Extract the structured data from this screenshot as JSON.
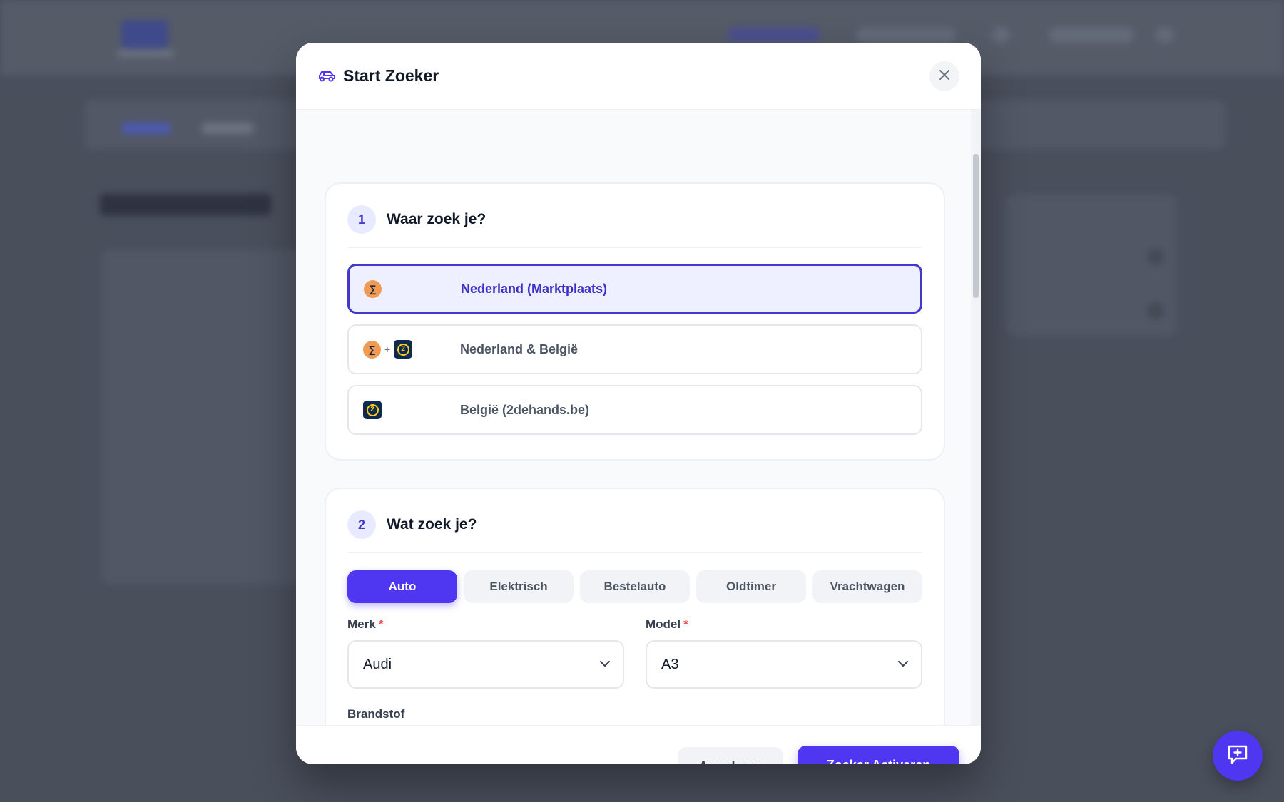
{
  "modal": {
    "title": "Start Zoeker",
    "icon": "car-icon",
    "close_icon": "close-icon"
  },
  "section1": {
    "step": "1",
    "title": "Waar zoek je?",
    "options": [
      {
        "label": "Nederland (Marktplaats)",
        "selected": true,
        "icons": [
          "marktplaats-logo-icon"
        ]
      },
      {
        "label": "Nederland & België",
        "selected": false,
        "icons": [
          "marktplaats-logo-icon",
          "2dehands-logo-icon"
        ],
        "separator": "+"
      },
      {
        "label": "België (2dehands.be)",
        "selected": false,
        "icons": [
          "2dehands-logo-icon"
        ]
      }
    ]
  },
  "section2": {
    "step": "2",
    "title": "Wat zoek je?",
    "vehicle_types": [
      {
        "label": "Auto",
        "active": true
      },
      {
        "label": "Elektrisch",
        "active": false
      },
      {
        "label": "Bestelauto",
        "active": false
      },
      {
        "label": "Oldtimer",
        "active": false
      },
      {
        "label": "Vrachtwagen",
        "active": false
      }
    ],
    "merk": {
      "label": "Merk",
      "required_mark": "*",
      "value": "Audi"
    },
    "model": {
      "label": "Model",
      "required_mark": "*",
      "value": "A3"
    },
    "brandstof": {
      "label": "Brandstof"
    }
  },
  "footer": {
    "cancel_label": "Annuleren",
    "activate_label": "Zoeker Activeren"
  },
  "fab": {
    "icon": "add-message-icon"
  },
  "colors": {
    "primary": "#4f36f0",
    "selected_bg": "#eef0ff",
    "selected_border": "#4338ca",
    "required": "#ef4444",
    "overlay": "#4a4f5c"
  }
}
